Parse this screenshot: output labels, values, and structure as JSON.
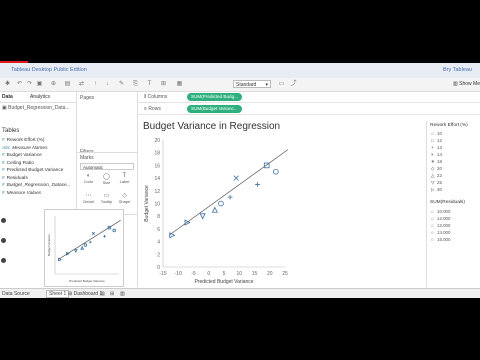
{
  "app": {
    "title": "Tableau Desktop Public Edition",
    "user": "Bry Tableau",
    "show_me": "Show Me"
  },
  "toolbar": {
    "fit_select": "Standard"
  },
  "data_panel": {
    "tab_data": "Data",
    "tab_analytics": "Analytics",
    "source": "Budget_Regression_Data...",
    "tables_header": "Tables",
    "fields": [
      {
        "name": "Rework Effort (%)",
        "glyph": "#",
        "italic": false
      },
      {
        "name": "Measure Names",
        "glyph": "Abc",
        "italic": true
      },
      {
        "name": "Budget Variance",
        "glyph": "#",
        "italic": false
      },
      {
        "name": "Ceiling Ratio",
        "glyph": "#",
        "italic": false
      },
      {
        "name": "Predicted Budget Variance",
        "glyph": "#",
        "italic": false
      },
      {
        "name": "Residuals",
        "glyph": "#",
        "italic": false
      },
      {
        "name": "Budget_Regression_Datase...",
        "glyph": "#",
        "italic": true
      },
      {
        "name": "Measure Values",
        "glyph": "#",
        "italic": true
      }
    ]
  },
  "cards": {
    "pages": "Pages",
    "filters": "Filters",
    "marks": "Marks",
    "mark_type": "Automatic",
    "buttons": [
      {
        "label": "Color",
        "icon": "color-icon"
      },
      {
        "label": "Size",
        "icon": "size-icon"
      },
      {
        "label": "Label",
        "icon": "label-icon"
      },
      {
        "label": "Detail",
        "icon": "detail-icon"
      },
      {
        "label": "Tooltip",
        "icon": "tooltip-icon"
      },
      {
        "label": "Shape",
        "icon": "shape-icon"
      }
    ]
  },
  "shelves": {
    "columns_label": "Columns",
    "columns_pill": "SUM(Predicted Budg...",
    "rows_label": "Rows",
    "rows_pill": "SUM(Budget Varianc..."
  },
  "chart_data": {
    "type": "scatter",
    "title": "Budget Variance in Regression",
    "xlabel": "Predicted Budget Variance",
    "ylabel": "Budget Variance",
    "x_ticks": [
      "-15",
      "-10",
      "-5",
      "0",
      "5",
      "10",
      "15",
      "20",
      "25"
    ],
    "y_ticks": [
      "20",
      "18",
      "16",
      "14",
      "12",
      "10",
      "8",
      "6",
      "4",
      "2",
      "0"
    ],
    "xlim": [
      -15,
      25
    ],
    "ylim": [
      0,
      20
    ],
    "trend_line": [
      [
        -13,
        5
      ],
      [
        26,
        18.5
      ]
    ],
    "points": [
      {
        "x": -12,
        "y": 5,
        "shape": "triangle-right"
      },
      {
        "x": -7,
        "y": 7,
        "shape": "triangle-right"
      },
      {
        "x": -2,
        "y": 8,
        "shape": "triangle-down"
      },
      {
        "x": 2,
        "y": 9,
        "shape": "triangle-up"
      },
      {
        "x": 4,
        "y": 10,
        "shape": "circle"
      },
      {
        "x": 7,
        "y": 11,
        "shape": "cross"
      },
      {
        "x": 9,
        "y": 14,
        "shape": "x"
      },
      {
        "x": 16,
        "y": 13,
        "shape": "plus"
      },
      {
        "x": 19,
        "y": 16,
        "shape": "square"
      },
      {
        "x": 22,
        "y": 15,
        "shape": "circle"
      }
    ]
  },
  "legend": {
    "shapes_title": "Rework Effort (%)",
    "shape_items": [
      {
        "label": "10",
        "sym": "○"
      },
      {
        "label": "12",
        "sym": "□"
      },
      {
        "label": "13",
        "sym": "+"
      },
      {
        "label": "14",
        "sym": "×"
      },
      {
        "label": "18",
        "sym": "✳"
      },
      {
        "label": "20",
        "sym": "◇"
      },
      {
        "label": "22",
        "sym": "△"
      },
      {
        "label": "25",
        "sym": "▽"
      },
      {
        "label": "30",
        "sym": "▷"
      }
    ],
    "size_title": "SUM(Residuals)",
    "size_items": [
      "10.000",
      "12.000",
      "12.000",
      "14.000",
      "15.000"
    ]
  },
  "bottom_tabs": [
    "Data Source",
    "Sheet 1",
    "Dashboard 1"
  ],
  "inset": {
    "xlabel": "Predicted Budget Variance",
    "ylabel": "Budget Variance"
  }
}
